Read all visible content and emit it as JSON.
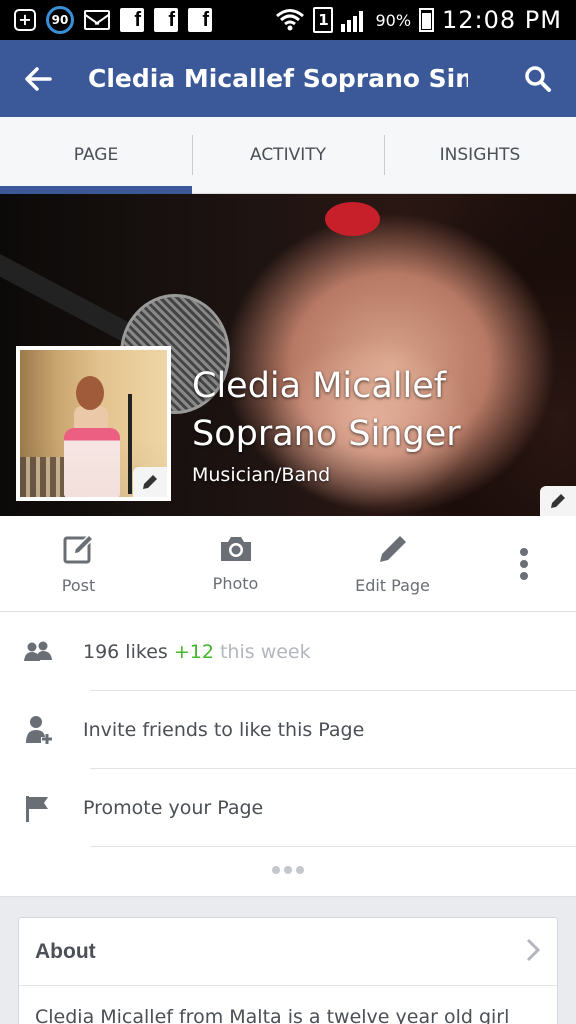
{
  "status_bar": {
    "notification_count": "90",
    "sim_slot": "1",
    "battery": "90%",
    "time": "12:08 PM",
    "fb_glyph": "f"
  },
  "app_bar": {
    "title": "Cledia Micallef Soprano Sin..."
  },
  "tabs": [
    {
      "label": "PAGE"
    },
    {
      "label": "ACTIVITY"
    },
    {
      "label": "INSIGHTS"
    }
  ],
  "page": {
    "name": "Cledia Micallef Soprano Singer",
    "category": "Musician/Band"
  },
  "actions": {
    "post": "Post",
    "photo": "Photo",
    "edit": "Edit Page"
  },
  "info": {
    "likes_count": "196 likes",
    "likes_delta": "+12",
    "likes_week": "this week",
    "invite": "Invite friends to like this Page",
    "promote": "Promote your Page"
  },
  "about": {
    "title": "About",
    "text": "Cledia Micallef from Malta is a twelve year old girl"
  },
  "colors": {
    "fb_blue": "#3b5998",
    "positive_green": "#42b72a",
    "text_gray": "#4b4f56"
  }
}
